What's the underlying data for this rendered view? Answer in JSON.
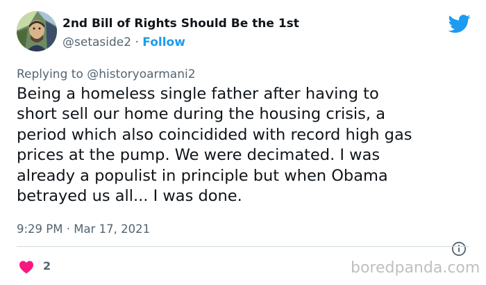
{
  "author": {
    "display_name": "2nd Bill of Rights Should Be the 1st",
    "handle": "@setaside2",
    "separator": "·",
    "follow_label": "Follow"
  },
  "reply": {
    "prefix": "Replying to",
    "to": "@historyoarmani2"
  },
  "tweet": {
    "text_lines": [
      "Being a homeless single father after having to",
      "short sell our home during the housing crisis, a",
      "period which also coincidided with record high gas",
      "prices at the pump. We were decimated. I was",
      "already a populist in principle but when Obama",
      "betrayed us all... I was done."
    ],
    "time": "9:29 PM",
    "separator": "·",
    "date": "Mar 17, 2021"
  },
  "engagement": {
    "likes": "2"
  },
  "watermark": "boredpanda.com",
  "colors": {
    "twitter_blue": "#1d9bf0",
    "heart": "#f91880",
    "secondary_text": "#536471"
  },
  "icons": {
    "logo": "twitter-bird-icon",
    "info": "info-icon",
    "like": "heart-icon"
  }
}
